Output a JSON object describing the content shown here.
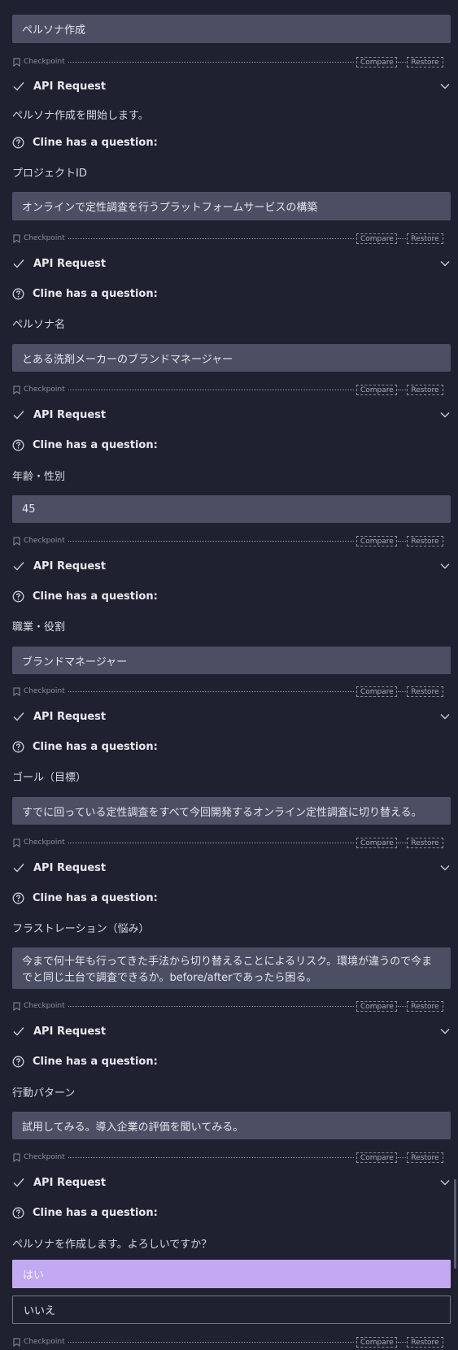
{
  "bubbles": [
    "ペルソナ作成",
    "オンラインで定性調査を行うプラットフォームサービスの構築",
    "とある洗剤メーカーのブランドマネージャー",
    "45",
    "ブランドマネージャー",
    "すでに回っている定性調査をすべて今回開発するオンライン定性調査に切り替える。",
    "今まで何十年も行ってきた手法から切り替えることによるリスク。環境が違うので今までと同じ土台で調査できるか。before/afterであったら困る。",
    "試用してみる。導入企業の評価を聞いてみる。"
  ],
  "checkpoint": {
    "label": "Checkpoint",
    "compare": "Compare",
    "restore": "Restore"
  },
  "api_request_label": "API Request",
  "question_label": "Cline has a question:",
  "texts": [
    "ペルソナ作成を開始します。",
    "プロジェクトID",
    "ペルソナ名",
    "年齢・性別",
    "職業・役割",
    "ゴール（目標）",
    "フラストレーション（悩み）",
    "行動パターン",
    "ペルソナを作成します。よろしいですか？"
  ],
  "options": {
    "yes": "はい",
    "no": "いいえ"
  },
  "icons": {
    "checkpoint": "bookmark-icon",
    "api": "check-icon",
    "expand": "chevron-down-icon",
    "question": "question-circle-icon"
  },
  "colors": {
    "background": "#1f2130",
    "bubble": "#4c4f64",
    "accent_option": "#c3a9f2"
  }
}
